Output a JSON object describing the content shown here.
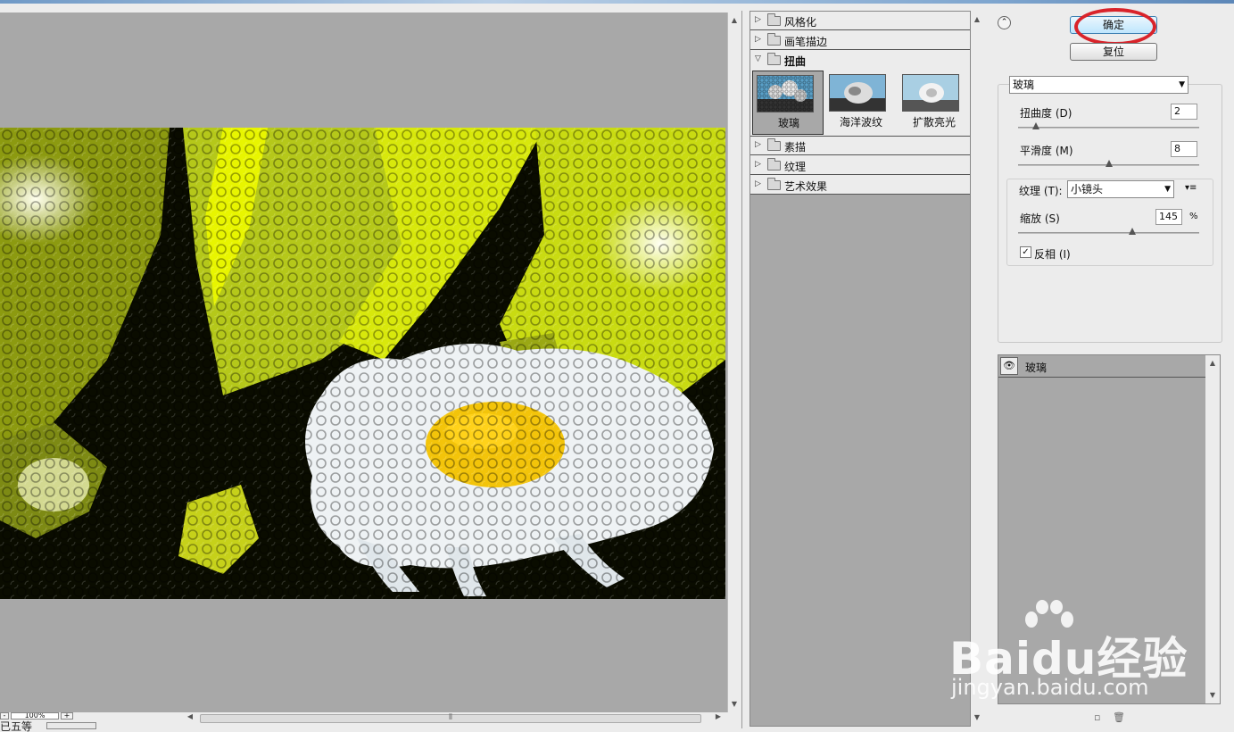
{
  "buttons": {
    "ok": "确定",
    "reset": "复位",
    "collapse": "⌃"
  },
  "categories": [
    {
      "label": "风格化",
      "expanded": false
    },
    {
      "label": "画笔描边",
      "expanded": false
    },
    {
      "label": "扭曲",
      "expanded": true
    },
    {
      "label": "素描",
      "expanded": false
    },
    {
      "label": "纹理",
      "expanded": false
    },
    {
      "label": "艺术效果",
      "expanded": false
    }
  ],
  "filters": [
    {
      "label": "玻璃",
      "selected": true
    },
    {
      "label": "海洋波纹",
      "selected": false
    },
    {
      "label": "扩散亮光",
      "selected": false
    }
  ],
  "options": {
    "filter_select": "玻璃",
    "distortion": {
      "label": "扭曲度 (D)",
      "value": "2",
      "level": 0.1
    },
    "smoothness": {
      "label": "平滑度 (M)",
      "value": "8",
      "level": 0.5
    },
    "texture": {
      "label": "纹理 (T):",
      "value": "小镜头"
    },
    "scaling": {
      "label": "缩放 (S)",
      "value": "145",
      "unit": "%",
      "level": 0.63
    },
    "invert": {
      "label": "反相 (I)",
      "checked": true
    }
  },
  "layers": [
    {
      "label": "玻璃"
    }
  ],
  "zoom": {
    "value": "100%",
    "minus": "-",
    "plus": "+"
  },
  "status": {
    "text": "已五等"
  },
  "watermark": {
    "brand": "Baidu经验",
    "url": "jingyan.baidu.com"
  },
  "colors": {
    "highlight": "#d9232a",
    "canvas_gray": "#a8a8a8",
    "panel": "#ececec"
  }
}
